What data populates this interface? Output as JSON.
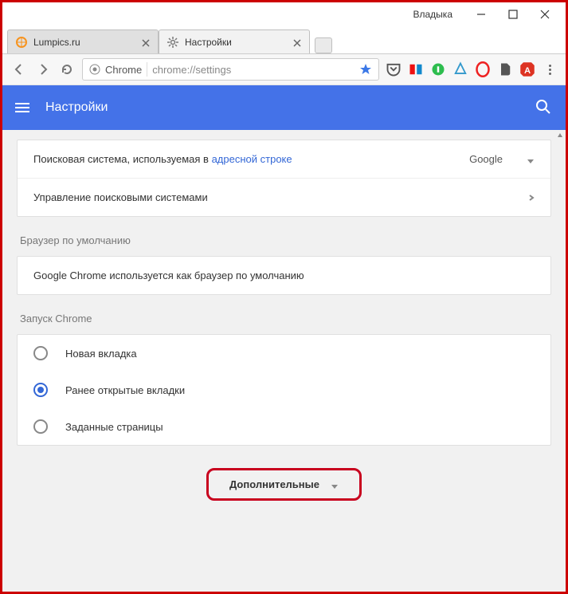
{
  "window": {
    "user_label": "Владыка"
  },
  "tabs": [
    {
      "title": "Lumpics.ru",
      "active": false
    },
    {
      "title": "Настройки",
      "active": true
    }
  ],
  "omnibox": {
    "origin_label": "Chrome",
    "url_text": "chrome://settings"
  },
  "appbar": {
    "title": "Настройки"
  },
  "search_engine": {
    "row_text_prefix": "Поисковая система, используемая в ",
    "row_text_link": "адресной строке",
    "selected": "Google",
    "manage_label": "Управление поисковыми системами"
  },
  "default_browser": {
    "section_label": "Браузер по умолчанию",
    "status_text": "Google Chrome используется как браузер по умолчанию"
  },
  "on_startup": {
    "section_label": "Запуск Chrome",
    "options": [
      {
        "label": "Новая вкладка",
        "checked": false
      },
      {
        "label": "Ранее открытые вкладки",
        "checked": true
      },
      {
        "label": "Заданные страницы",
        "checked": false
      }
    ]
  },
  "advanced": {
    "button_label": "Дополнительные"
  }
}
